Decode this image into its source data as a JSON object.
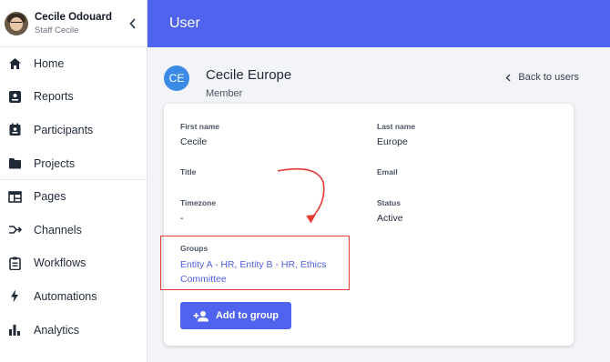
{
  "sidebar": {
    "user": {
      "name": "Cecile Odouard",
      "role": "Staff Cecile"
    },
    "items": [
      {
        "label": "Home",
        "icon": "home-icon"
      },
      {
        "label": "Reports",
        "icon": "reports-icon"
      },
      {
        "label": "Participants",
        "icon": "participants-icon"
      },
      {
        "label": "Projects",
        "icon": "folder-icon"
      },
      {
        "label": "Pages",
        "icon": "pages-icon"
      },
      {
        "label": "Channels",
        "icon": "channels-icon"
      },
      {
        "label": "Workflows",
        "icon": "clipboard-icon"
      },
      {
        "label": "Automations",
        "icon": "bolt-icon"
      },
      {
        "label": "Analytics",
        "icon": "bar-chart-icon"
      }
    ]
  },
  "topbar": {
    "title": "User"
  },
  "header": {
    "initials": "CE",
    "name": "Cecile Europe",
    "role": "Member",
    "back_label": "Back to users"
  },
  "fields": {
    "first_name": {
      "label": "First name",
      "value": "Cecile"
    },
    "last_name": {
      "label": "Last name",
      "value": "Europe"
    },
    "title": {
      "label": "Title",
      "value": ""
    },
    "email": {
      "label": "Email",
      "value": ""
    },
    "timezone": {
      "label": "Timezone",
      "value": "-"
    },
    "status": {
      "label": "Status",
      "value": "Active"
    }
  },
  "groups": {
    "label": "Groups",
    "links": [
      "Entity A - HR",
      "Entity B - HR",
      "Ethics Committee"
    ]
  },
  "add_button_label": "Add to group",
  "colors": {
    "accent": "#4f63ee",
    "highlight": "#e53935",
    "link": "#4f5fe0"
  }
}
